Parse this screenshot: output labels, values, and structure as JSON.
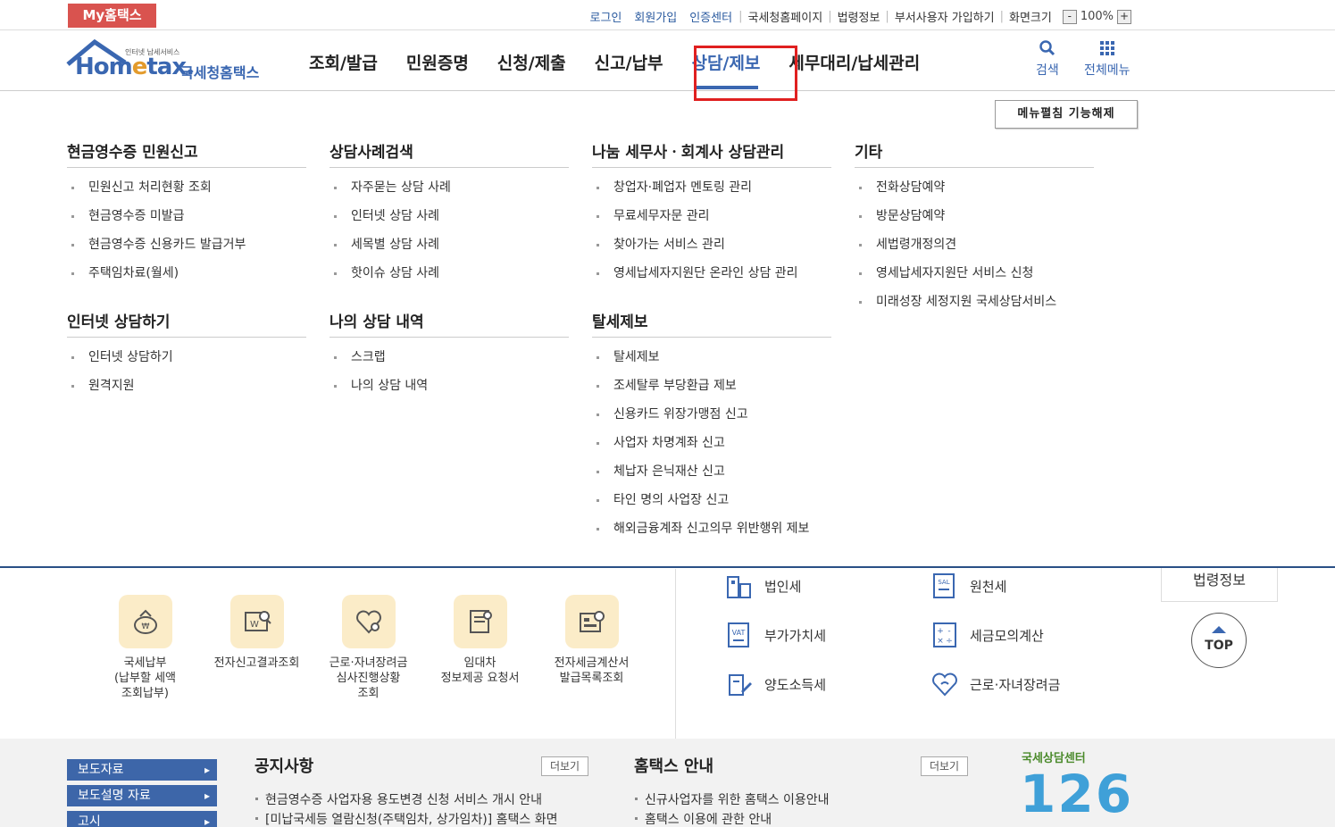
{
  "topbar": {
    "my_hometax": "My홈택스",
    "links": [
      "로그인",
      "회원가입",
      "인증센터"
    ],
    "gray_links": [
      "국세청홈페이지",
      "법령정보",
      "부서사용자 가입하기",
      "화면크기"
    ],
    "zoom_minus": "-",
    "zoom_value": "100%",
    "zoom_plus": "+"
  },
  "header": {
    "logo_tiny": "인터넷 납세서비스",
    "logo_word_a": "Hom",
    "logo_word_e": "e",
    "logo_word_b": "tax.",
    "logo_kr": "국세청홈택스",
    "nav": [
      "조회/발급",
      "민원증명",
      "신청/제출",
      "신고/납부",
      "상담/제보",
      "세무대리/납세관리"
    ],
    "active_nav": "상담/제보",
    "search_label": "검색",
    "allmenu_label": "전체메뉴"
  },
  "fold_button": "메뉴펼침 기능해제",
  "menu": {
    "col1": {
      "s1_title": "현금영수증 민원신고",
      "s1_items": [
        "민원신고 처리현황 조회",
        "현금영수증 미발급",
        "현금영수증 신용카드 발급거부",
        "주택임차료(월세)"
      ],
      "s2_title": "인터넷 상담하기",
      "s2_items": [
        "인터넷 상담하기",
        "원격지원"
      ]
    },
    "col2": {
      "s1_title": "상담사례검색",
      "s1_items": [
        "자주묻는 상담 사례",
        "인터넷 상담 사례",
        "세목별 상담 사례",
        "핫이슈 상담 사례"
      ],
      "s2_title": "나의 상담 내역",
      "s2_items": [
        "스크랩",
        "나의 상담 내역"
      ]
    },
    "col3": {
      "s1_title": "나눔 세무사ㆍ회계사 상담관리",
      "s1_items": [
        "창업자·폐업자 멘토링 관리",
        "무료세무자문 관리",
        "찾아가는 서비스 관리",
        "영세납세자지원단 온라인 상담 관리"
      ],
      "s2_title": "탈세제보",
      "s2_items": [
        "탈세제보",
        "조세탈루 부당환급 제보",
        "신용카드 위장가맹점 신고",
        "사업자 차명계좌 신고",
        "체납자 은닉재산 신고",
        "타인 명의 사업장 신고",
        "해외금융계좌 신고의무 위반행위 제보"
      ]
    },
    "col4": {
      "s1_title": "기타",
      "s1_items": [
        "전화상담예약",
        "방문상담예약",
        "세법령개정의견",
        "영세납세자지원단 서비스 신청",
        "미래성장 세정지원 국세상담서비스"
      ]
    }
  },
  "quick": [
    {
      "l1": "국세납부",
      "l2": "(납부할 세액",
      "l3": "조회납부)"
    },
    {
      "l1": "전자신고결과조회",
      "l2": "",
      "l3": ""
    },
    {
      "l1": "근로·자녀장려금",
      "l2": "심사진행상황",
      "l3": "조회"
    },
    {
      "l1": "임대차",
      "l2": "정보제공 요청서",
      "l3": ""
    },
    {
      "l1": "전자세금계산서",
      "l2": "발급목록조회",
      "l3": ""
    }
  ],
  "taxes": [
    "법인세",
    "원천세",
    "부가가치세",
    "세금모의계산",
    "양도소득세",
    "근로·자녀장려금"
  ],
  "law_button": "법령정보",
  "top_button": "TOP",
  "bottom": {
    "left_buttons": [
      "보도자료",
      "보도설명 자료",
      "고시"
    ],
    "notice_title": "공지사항",
    "notice_more": "더보기",
    "notice_items": [
      "현금영수증 사업자용 용도변경 신청 서비스 개시 안내",
      "[미납국세등 열람신청(주택임차, 상가임차)] 홈택스 화면"
    ],
    "guide_title": "홈택스 안내",
    "guide_more": "더보기",
    "guide_items": [
      "신규사업자를 위한 홈택스 이용안내",
      "홈택스 이용에 관한 안내"
    ],
    "center_label": "국세상담센터",
    "center_number": "126"
  },
  "colors": {
    "brand_blue": "#3a67b1",
    "my_hometax_red": "#d9534f",
    "highlight_red": "#e02020",
    "quick_icon_bg": "#fbecc8"
  }
}
